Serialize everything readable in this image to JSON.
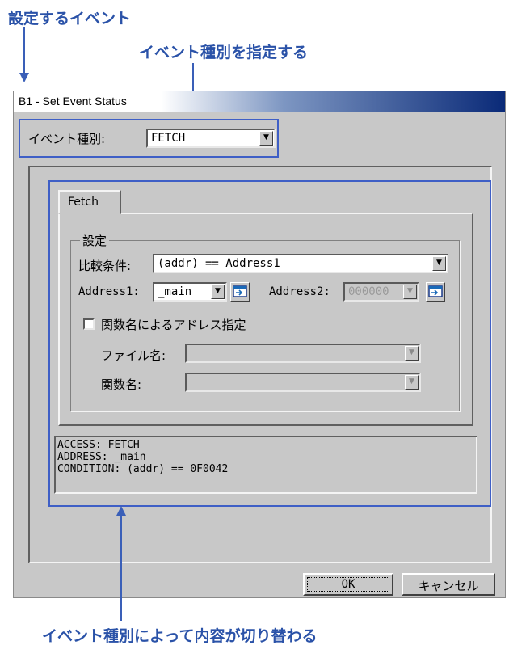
{
  "annotations": {
    "top_left": "設定するイベント",
    "top_right": "イベント種別を指定する",
    "bottom": "イベント種別によって内容が切り替わる"
  },
  "dialog": {
    "title": "B1 - Set Event Status",
    "event_type_label": "イベント種別:",
    "event_type_value": "FETCH",
    "tab_label": "Fetch",
    "group_label": "設定",
    "compare_label": "比較条件:",
    "compare_value": "(addr) == Address1",
    "address1_label": "Address1:",
    "address1_value": "_main",
    "address2_label": "Address2:",
    "address2_value": "000000",
    "checkbox_label": "関数名によるアドレス指定",
    "checkbox_checked": false,
    "file_label": "ファイル名:",
    "file_value": "",
    "function_label": "関数名:",
    "function_value": "",
    "info_lines": [
      "ACCESS: FETCH",
      "ADDRESS: _main",
      "CONDITION: (addr) == 0F0042"
    ],
    "ok_label": "OK",
    "cancel_label": "キャンセル"
  },
  "icons": {
    "dropdown": "triangle-down",
    "browse": "address-browse-icon"
  },
  "colors": {
    "annotation": "#2a52a8",
    "highlight_border": "#3f5fc6",
    "dialog_bg": "#c8c8c8",
    "title_gradient_end": "#0a2a78"
  }
}
